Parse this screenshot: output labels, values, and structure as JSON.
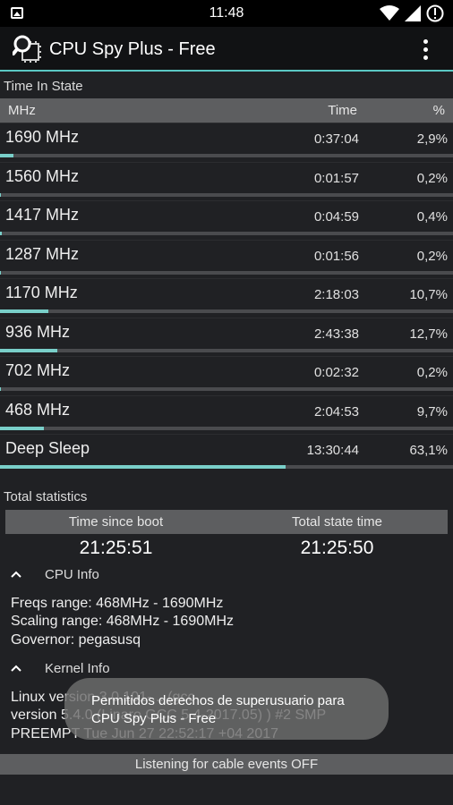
{
  "statusbar": {
    "time": "11:48"
  },
  "appbar": {
    "title": "CPU Spy Plus - Free"
  },
  "time_in_state": {
    "label": "Time In State",
    "columns": {
      "mhz": "MHz",
      "time": "Time",
      "pct": "%"
    },
    "rows": [
      {
        "freq": "1690 MHz",
        "time": "0:37:04",
        "pct": "2,9%",
        "fraction": 0.029
      },
      {
        "freq": "1560 MHz",
        "time": "0:01:57",
        "pct": "0,2%",
        "fraction": 0.002
      },
      {
        "freq": "1417 MHz",
        "time": "0:04:59",
        "pct": "0,4%",
        "fraction": 0.004
      },
      {
        "freq": "1287 MHz",
        "time": "0:01:56",
        "pct": "0,2%",
        "fraction": 0.002
      },
      {
        "freq": "1170 MHz",
        "time": "2:18:03",
        "pct": "10,7%",
        "fraction": 0.107
      },
      {
        "freq": "936 MHz",
        "time": "2:43:38",
        "pct": "12,7%",
        "fraction": 0.127
      },
      {
        "freq": "702 MHz",
        "time": "0:02:32",
        "pct": "0,2%",
        "fraction": 0.002
      },
      {
        "freq": "468 MHz",
        "time": "2:04:53",
        "pct": "9,7%",
        "fraction": 0.097
      },
      {
        "freq": "Deep Sleep",
        "time": "13:30:44",
        "pct": "63,1%",
        "fraction": 0.631
      }
    ]
  },
  "total_statistics": {
    "label": "Total statistics",
    "since_boot_label": "Time since boot",
    "since_boot_value": "21:25:51",
    "state_time_label": "Total state time",
    "state_time_value": "21:25:50"
  },
  "cpu_info": {
    "label": "CPU Info",
    "freqs_range": "Freqs range: 468MHz - 1690MHz",
    "scaling_range": "Scaling range: 468MHz - 1690MHz",
    "governor": "Governor: pegasusq"
  },
  "kernel_info": {
    "label": "Kernel Info",
    "line1": "Linux version 3.0.101-... (gcc",
    "line2": "version 5.4.0 (Linaro GCC 5.4-2017.05) ) #2 SMP",
    "line3": "PREEMPT Tue Jun 27 22:52:17 +04 2017"
  },
  "toast": {
    "line1": "Permitidos derechos de superusuario para",
    "line2": "CPU Spy Plus - Free"
  },
  "footer": {
    "status": "Listening for cable events OFF"
  },
  "colors": {
    "accent": "#5bc8c4",
    "bar_fill": "#79cfc9",
    "header_bg": "#5d5e60"
  }
}
